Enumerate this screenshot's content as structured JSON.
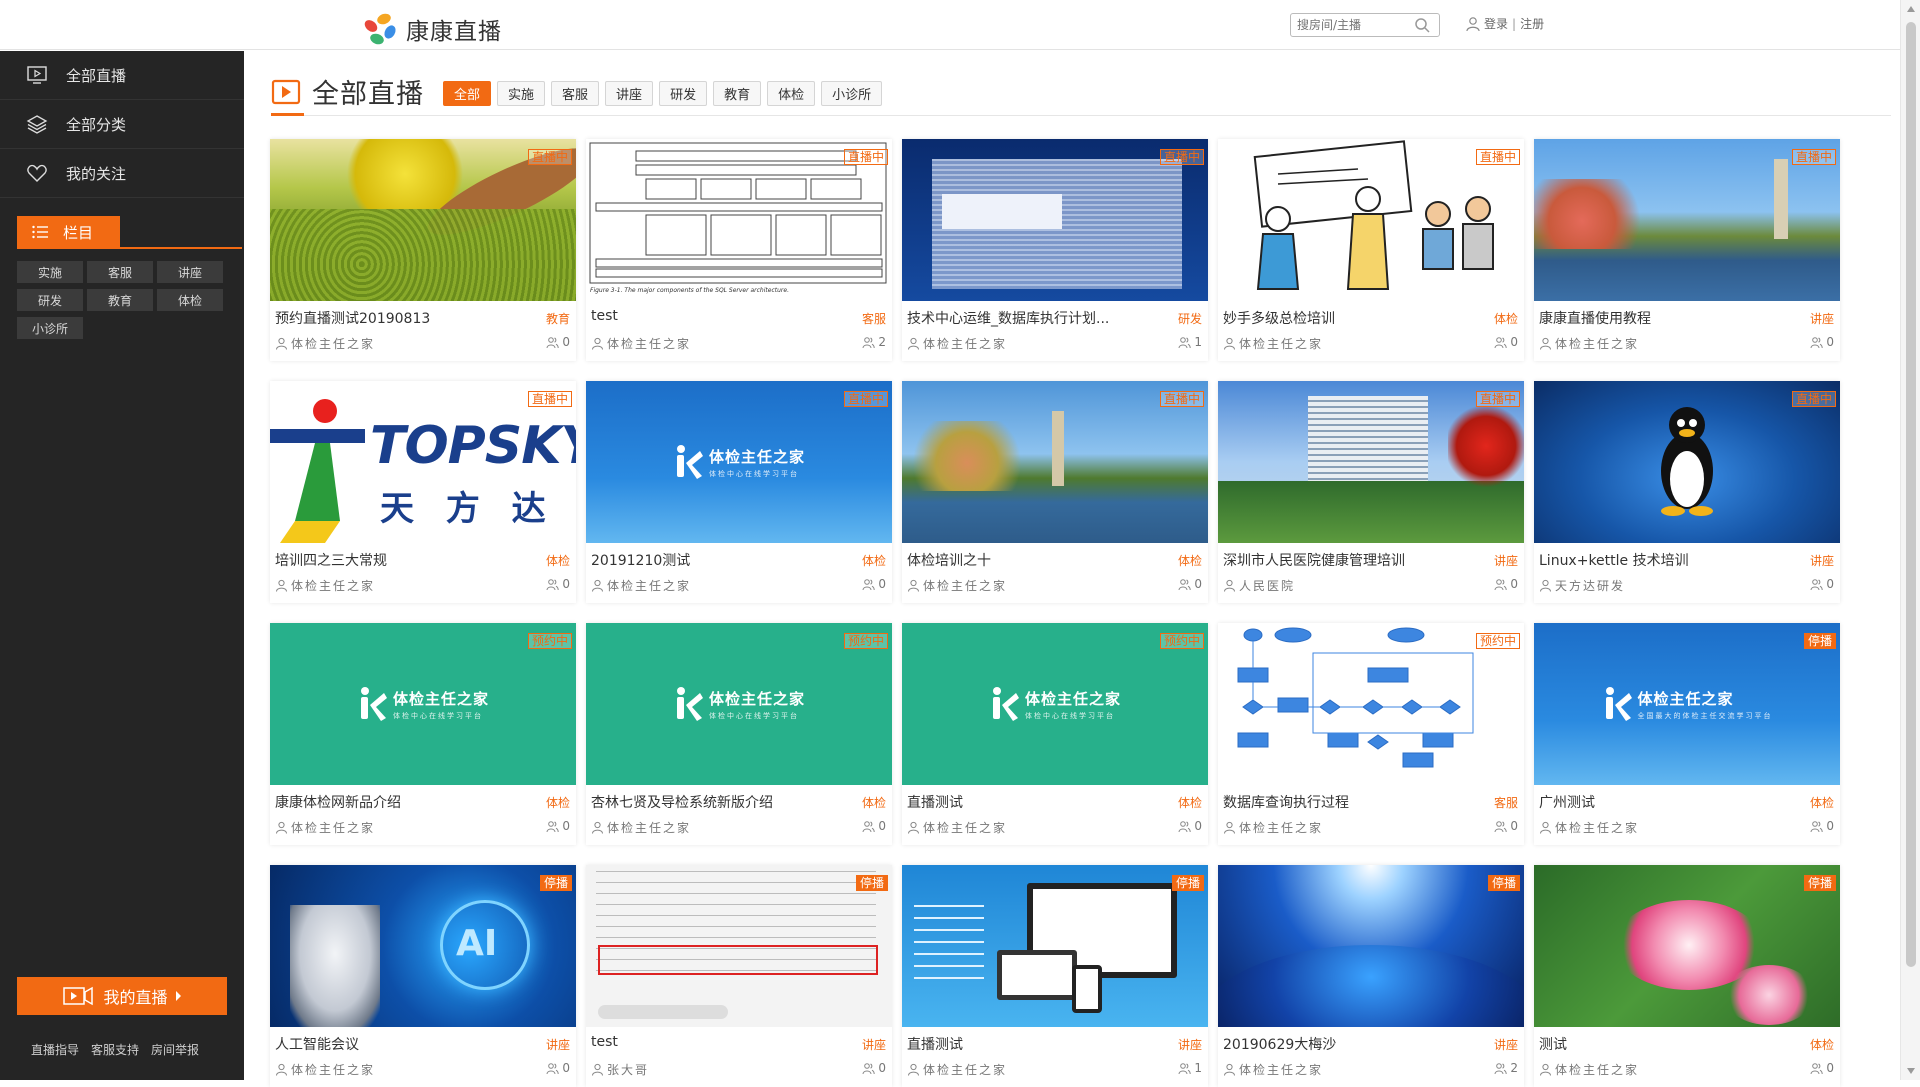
{
  "app": {
    "logo_text": "康康直播",
    "search_placeholder": "搜房间/主播",
    "login": "登录",
    "separator": "|",
    "register": "注册"
  },
  "sidebar": {
    "nav": [
      {
        "label": "全部直播",
        "icon": "tv-play-icon"
      },
      {
        "label": "全部分类",
        "icon": "layers-icon"
      },
      {
        "label": "我的关注",
        "icon": "heart-icon"
      }
    ],
    "column_header": "栏目",
    "tags": [
      "实施",
      "客服",
      "讲座",
      "研发",
      "教育",
      "体检",
      "小诊所"
    ],
    "live_button": "我的直播",
    "footer_links": [
      "直播指导",
      "客服支持",
      "房间举报"
    ]
  },
  "main": {
    "title": "全部直播",
    "filters": [
      "全部",
      "实施",
      "客服",
      "讲座",
      "研发",
      "教育",
      "体检",
      "小诊所"
    ],
    "active_filter": "全部"
  },
  "cards": [
    {
      "title": "预约直播测试20190813",
      "category": "教育",
      "host": "体检主任之家",
      "viewers": "0",
      "status": "直播中",
      "thumb": "beans"
    },
    {
      "title": "test",
      "category": "客服",
      "host": "体检主任之家",
      "viewers": "2",
      "status": "直播中",
      "thumb": "diagram"
    },
    {
      "title": "技术中心运维_数据库执行计划...",
      "category": "研发",
      "host": "体检主任之家",
      "viewers": "1",
      "status": "直播中",
      "thumb": "screen"
    },
    {
      "title": "妙手多级总检培训",
      "category": "体检",
      "host": "体检主任之家",
      "viewers": "0",
      "status": "直播中",
      "thumb": "cartoon"
    },
    {
      "title": "康康直播使用教程",
      "category": "讲座",
      "host": "体检主任之家",
      "viewers": "0",
      "status": "直播中",
      "thumb": "lake"
    },
    {
      "title": "培训四之三大常规",
      "category": "体检",
      "host": "体检主任之家",
      "viewers": "0",
      "status": "直播中",
      "thumb": "topsky"
    },
    {
      "title": "20191210测试",
      "category": "体检",
      "host": "体检主任之家",
      "viewers": "0",
      "status": "直播中",
      "thumb": "bluebrand"
    },
    {
      "title": "体检培训之十",
      "category": "体检",
      "host": "体检主任之家",
      "viewers": "0",
      "status": "直播中",
      "thumb": "lake2"
    },
    {
      "title": "深圳市人民医院健康管理培训",
      "category": "讲座",
      "host": "人民医院",
      "viewers": "0",
      "status": "直播中",
      "thumb": "hospital"
    },
    {
      "title": "Linux+kettle 技术培训",
      "category": "讲座",
      "host": "天方达研发",
      "viewers": "0",
      "status": "直播中",
      "thumb": "linux"
    },
    {
      "title": "康康体检网新品介绍",
      "category": "体检",
      "host": "体检主任之家",
      "viewers": "0",
      "status": "预约中",
      "thumb": "teal"
    },
    {
      "title": "杏林七贤及导检系统新版介绍",
      "category": "体检",
      "host": "体检主任之家",
      "viewers": "0",
      "status": "预约中",
      "thumb": "teal"
    },
    {
      "title": "直播测试",
      "category": "体检",
      "host": "体检主任之家",
      "viewers": "0",
      "status": "预约中",
      "thumb": "teal"
    },
    {
      "title": "数据库查询执行过程",
      "category": "客服",
      "host": "体检主任之家",
      "viewers": "0",
      "status": "预约中",
      "thumb": "flow"
    },
    {
      "title": "广州测试",
      "category": "体检",
      "host": "体检主任之家",
      "viewers": "0",
      "status": "停播",
      "thumb": "bluebrand2"
    },
    {
      "title": "人工智能会议",
      "category": "讲座",
      "host": "体检主任之家",
      "viewers": "0",
      "status": "停播",
      "thumb": "ai"
    },
    {
      "title": "test",
      "category": "讲座",
      "host": "张大哥",
      "viewers": "0",
      "status": "停播",
      "thumb": "doc"
    },
    {
      "title": "直播测试",
      "category": "讲座",
      "host": "体检主任之家",
      "viewers": "1",
      "status": "停播",
      "thumb": "devices"
    },
    {
      "title": "20190629大梅沙",
      "category": "讲座",
      "host": "体检主任之家",
      "viewers": "2",
      "status": "停播",
      "thumb": "space"
    },
    {
      "title": "测试",
      "category": "体检",
      "host": "体检主任之家",
      "viewers": "0",
      "status": "停播",
      "thumb": "flower"
    }
  ],
  "thumb_texts": {
    "brand": "体检主任之家",
    "brand_sub": "体检中心在线学习平台",
    "brand_sub2": "全国最大的体检主任交流学习平台",
    "topsky": "TOPSKY",
    "topsky_cn": "天 方 达",
    "ai": "AI",
    "diagram_caption": "Figure 3-1. The major components of the SQL Server architecture."
  },
  "colors": {
    "accent": "#f26a13",
    "sidebar_bg": "#252525",
    "teal": "#27b08b",
    "brand_blue": "#1e73c8"
  }
}
